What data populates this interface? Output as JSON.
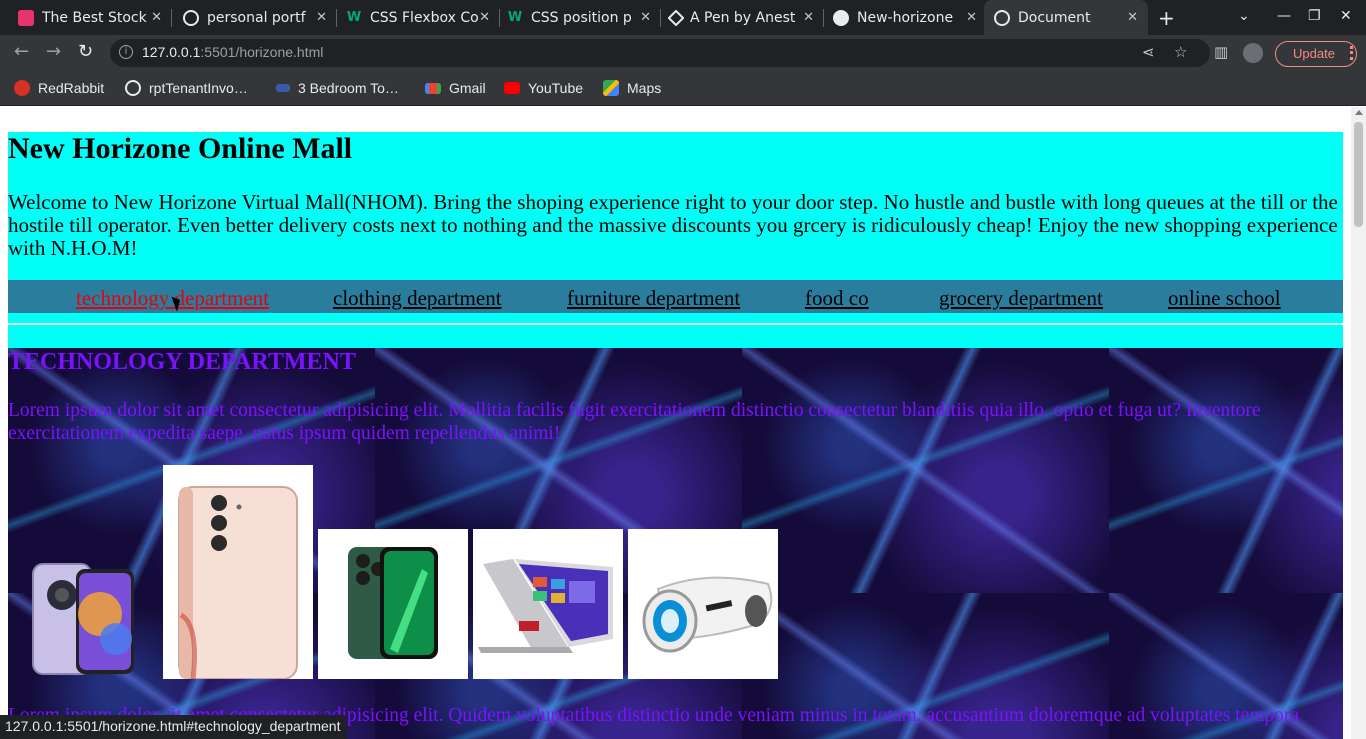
{
  "browser": {
    "tabs": [
      {
        "title": "The Best Stock",
        "favicon": "pink-app-icon"
      },
      {
        "title": "personal portf",
        "favicon": "globe-icon"
      },
      {
        "title": "CSS Flexbox Co",
        "favicon": "w3schools-icon"
      },
      {
        "title": "CSS position p",
        "favicon": "w3schools-icon"
      },
      {
        "title": "A Pen by Anest",
        "favicon": "codepen-icon"
      },
      {
        "title": "New-horizone",
        "favicon": "github-icon"
      },
      {
        "title": "Document",
        "favicon": "globe-icon",
        "active": true
      }
    ],
    "new_tab": "+",
    "url_host": "127.0.0.1",
    "url_rest": ":5501/horizone.html",
    "update_label": "Update",
    "bookmarks": [
      {
        "label": "RedRabbit",
        "icon": "redrabbit-icon"
      },
      {
        "label": "rptTenantInvo…",
        "icon": "globe-icon"
      },
      {
        "label": "3 Bedroom To…",
        "icon": "property-icon"
      },
      {
        "label": "Gmail",
        "icon": "gmail-icon"
      },
      {
        "label": "YouTube",
        "icon": "youtube-icon"
      },
      {
        "label": "Maps",
        "icon": "maps-icon"
      }
    ],
    "status_url": "127.0.0.1:5501/horizone.html#technology_department"
  },
  "page": {
    "title": "New Horizone Online Mall",
    "intro": "Welcome to New Horizone Virtual Mall(NHOM). Bring the shoping experience right to your door step. No hustle and bustle with long queues at the till or the hostile till operator. Even better delivery costs next to nothing and the massive discounts you grcery is ridiculously cheap! Enjoy the new shopping experience with N.H.O.M!",
    "nav": [
      {
        "label": "technology department",
        "hovered": true
      },
      {
        "label": "clothing department"
      },
      {
        "label": "furniture department"
      },
      {
        "label": "food co"
      },
      {
        "label": "grocery department"
      },
      {
        "label": "online school"
      }
    ],
    "technology": {
      "heading": "TECHNOLOGY DEPARTMENT",
      "lead": "Lorem ipsum dolor sit amet consectetur adipisicing elit. Mollitia facilis fugit exercitationem distinctio consectetur blanditiis quia illo, optio et fuga ut? Inventore exercitationem expedita saepe, natus ipsum quidem repellendus animi!",
      "lead2": "Lorem ipsum dolor sit amet consectetur adipisicing elit. Quidem voluptatibus distinctio unde veniam minus in totam, accusantium doloremque ad voluptates tempora quam labore!",
      "products": [
        "smartphone-purple",
        "smartphone-pink",
        "iphone-green",
        "laptop-convertible",
        "hoverboard"
      ]
    }
  },
  "colors": {
    "hero_bg": "#00fff7",
    "nav_bg": "#2a7d9d",
    "tech_text": "#7b12ff",
    "link_hover": "#e8000e"
  }
}
